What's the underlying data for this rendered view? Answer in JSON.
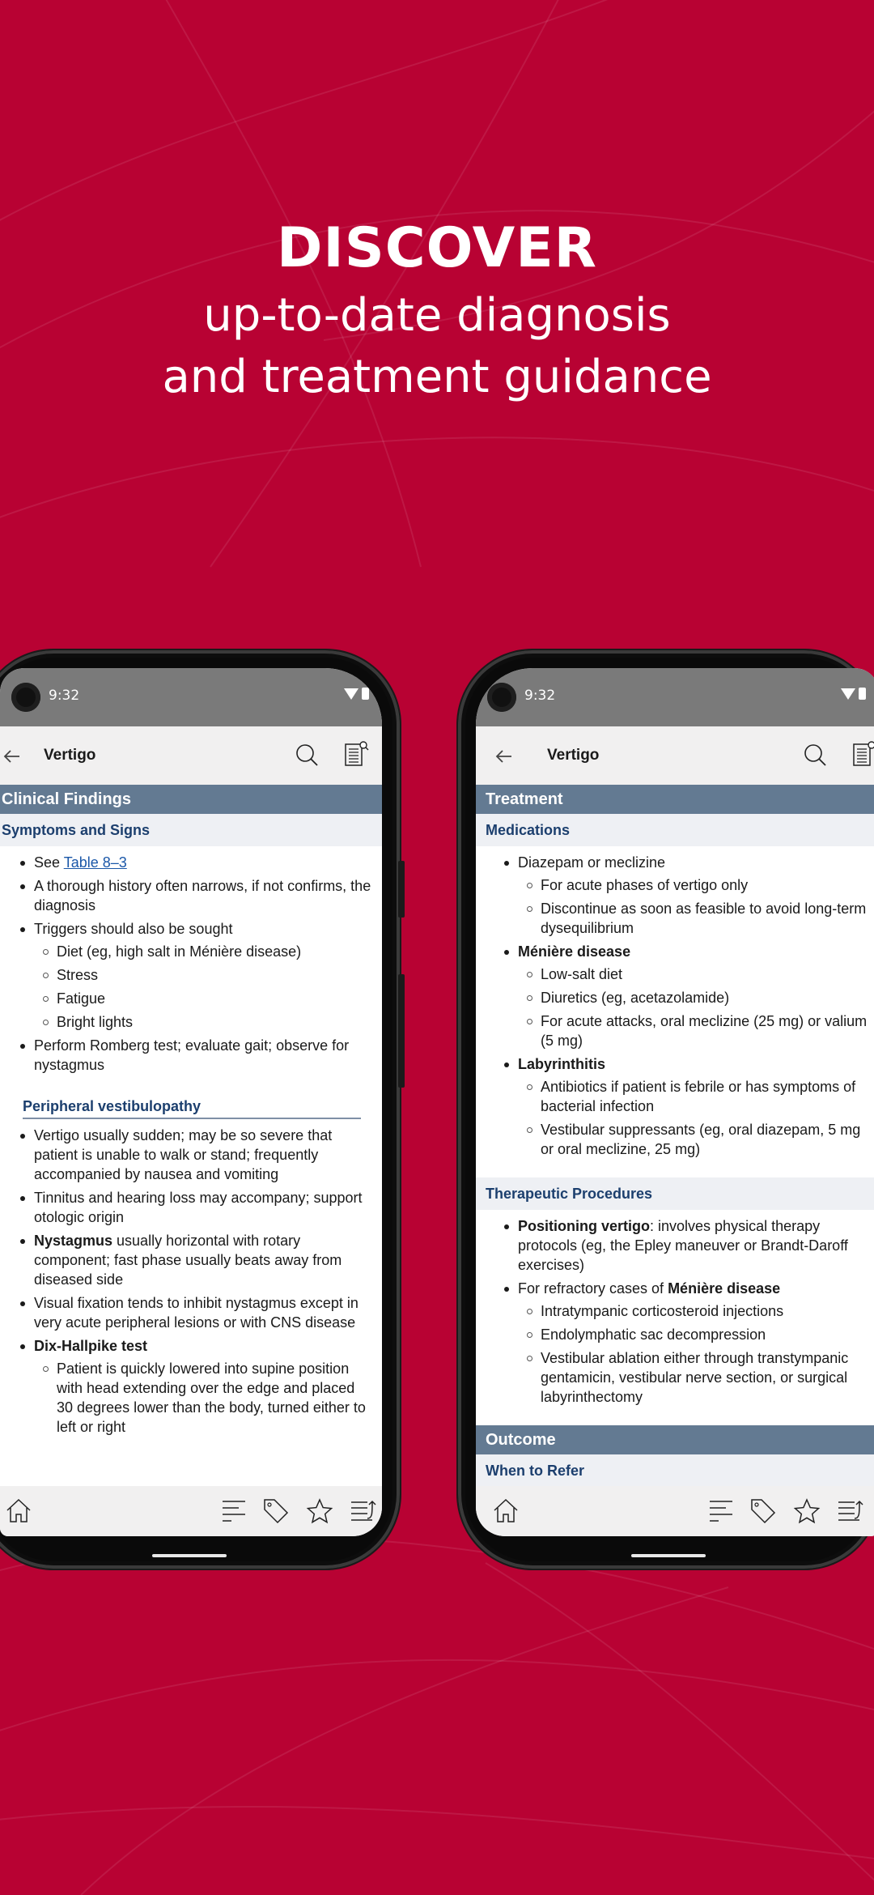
{
  "hero": {
    "title": "DISCOVER",
    "subtitle_line1": "up-to-date diagnosis",
    "subtitle_line2": "and treatment guidance"
  },
  "colors": {
    "background": "#b80233",
    "section_header": "#637a92",
    "subsection_text": "#1c3f6e",
    "link": "#1a57a8"
  },
  "phone_left": {
    "status_time": "9:32",
    "app_title": "Vertigo",
    "section": "Clinical Findings",
    "subsection": "Symptoms and Signs",
    "see_prefix": "See ",
    "see_link": "Table 8–3",
    "items": [
      "A thorough history often narrows, if not confirms, the diagnosis",
      "Triggers should also be sought"
    ],
    "triggers": [
      "Diet (eg, high salt in Ménière disease)",
      "Stress",
      "Fatigue",
      "Bright lights"
    ],
    "romberg": "Perform Romberg test; evaluate gait; observe for nystagmus",
    "pv_heading": "Peripheral vestibulopathy",
    "pv_items": [
      "Vertigo usually sudden; may be so severe that patient is unable to walk or stand; frequently accompanied by nausea and vomiting",
      "Tinnitus and hearing loss may accompany; support otologic origin"
    ],
    "nystagmus_bold": "Nystagmus",
    "nystagmus_rest": " usually horizontal with rotary component; fast phase usually beats away from diseased side",
    "visual_fixation": "Visual fixation tends to inhibit nystagmus except in very acute peripheral lesions or with CNS disease",
    "dix_hallpike": "Dix-Hallpike test",
    "dix_sub": "Patient is quickly lowered into supine position with head extending over the edge and placed 30 degrees lower than the body, turned either to left or right"
  },
  "phone_right": {
    "status_time": "9:32",
    "app_title": "Vertigo",
    "section": "Treatment",
    "subsection": "Medications",
    "med1": "Diazepam or meclizine",
    "med1_sub": [
      "For acute phases of vertigo only",
      "Discontinue as soon as feasible to avoid long-term dysequilibrium"
    ],
    "med2": "Ménière disease",
    "med2_sub": [
      "Low-salt diet",
      "Diuretics (eg, acetazolamide)",
      "For acute attacks, oral meclizine (25 mg) or valium (5 mg)"
    ],
    "med3": "Labyrinthitis",
    "med3_sub": [
      "Antibiotics if patient is febrile or has symptoms of bacterial infection",
      "Vestibular suppressants (eg, oral diazepam, 5 mg or oral meclizine, 25 mg)"
    ],
    "subsection2": "Therapeutic Procedures",
    "proc1_bold": "Positioning vertigo",
    "proc1_rest": ": involves physical therapy protocols (eg, the Epley maneuver or Brandt-Daroff exercises)",
    "proc2_prefix": "For refractory cases of ",
    "proc2_bold": "Ménière disease",
    "proc2_sub": [
      "Intratympanic corticosteroid injections",
      "Endolymphatic sac decompression",
      "Vestibular ablation either through transtympanic gentamicin, vestibular nerve section, or surgical labyrinthectomy"
    ],
    "section2": "Outcome",
    "subsection3": "When to Refer"
  }
}
